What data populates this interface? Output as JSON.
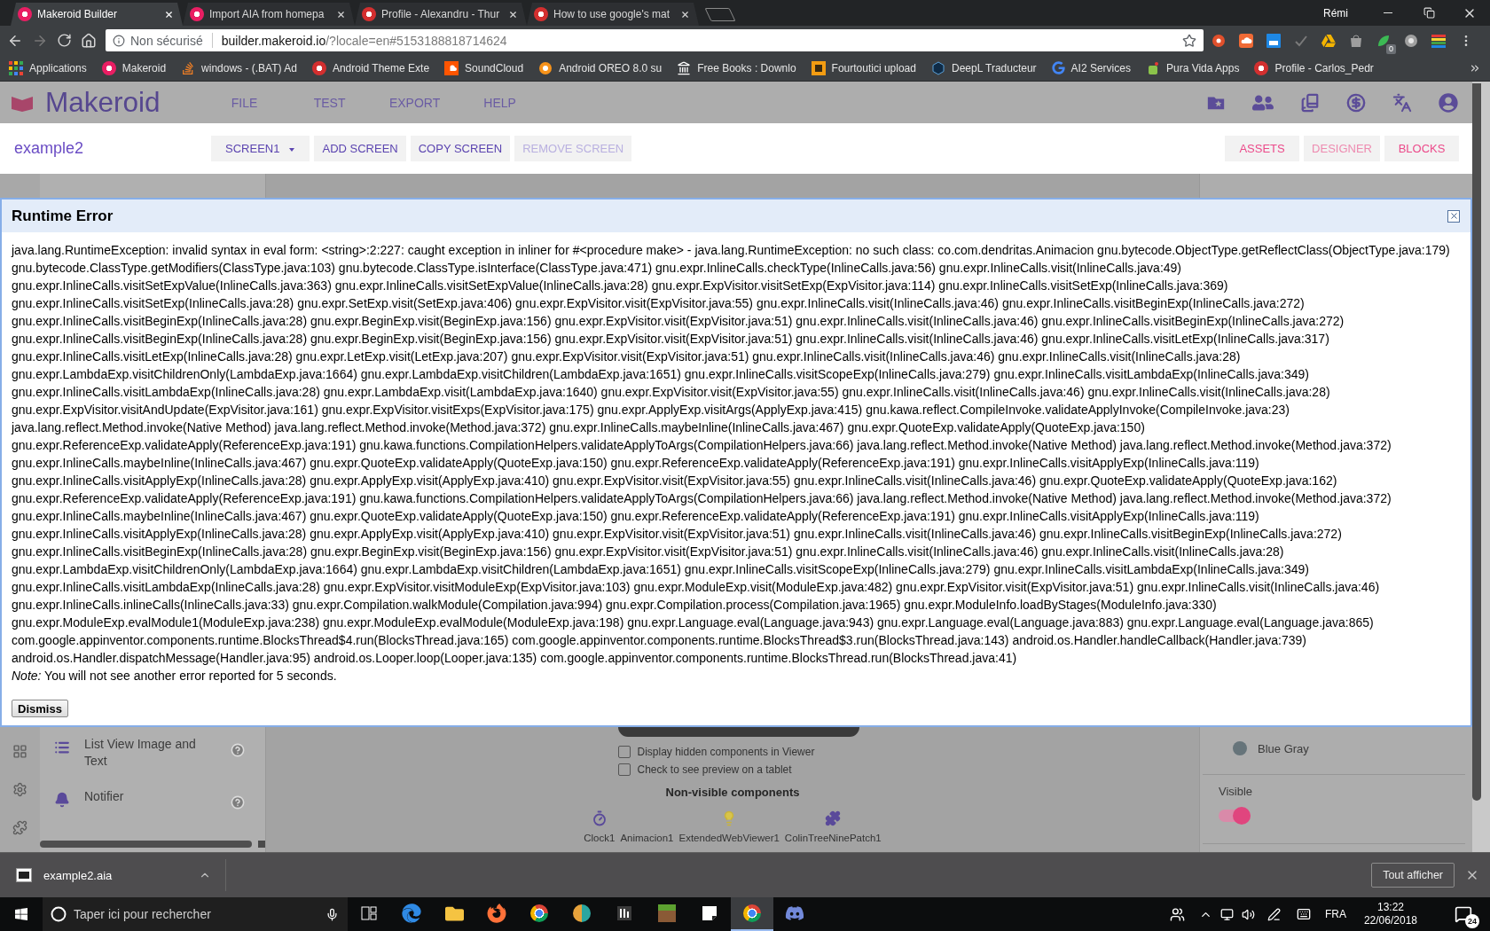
{
  "browser": {
    "tabs": [
      {
        "title": "Makeroid Builder",
        "selected": true
      },
      {
        "title": "Import AIA from homepa",
        "selected": false
      },
      {
        "title": "Profile - Alexandru - Thur",
        "selected": false
      },
      {
        "title": "How to use google's mat",
        "selected": false
      }
    ],
    "user": "Rémi",
    "address": {
      "security_label": "Non sécurisé",
      "host": "builder.makeroid.io",
      "path": "/?locale=en#5153188818714624"
    },
    "extension_badge": "0",
    "bookmarks": [
      "Applications",
      "Makeroid",
      "windows - (.BAT) Ad",
      "Android Theme Exte",
      "SoundCloud",
      "Android OREO 8.0 su",
      "Free Books : Downlo",
      "Fourtoutici upload",
      "DeepL Traducteur",
      "AI2 Services",
      "Pura Vida Apps",
      "Profile - Carlos_Pedr"
    ]
  },
  "app_header": {
    "logo_text": "Makeroid",
    "menu": [
      "FILE",
      "TEST",
      "EXPORT",
      "HELP"
    ]
  },
  "project_bar": {
    "project_name": "example2",
    "screen_actions": [
      {
        "label": "SCREEN1",
        "kind": "dropdown",
        "disabled": false
      },
      {
        "label": "ADD SCREEN",
        "kind": "button",
        "disabled": false
      },
      {
        "label": "COPY SCREEN",
        "kind": "button",
        "disabled": false
      },
      {
        "label": "REMOVE SCREEN",
        "kind": "button",
        "disabled": true
      }
    ],
    "editor_views": [
      {
        "label": "ASSETS",
        "selected": false
      },
      {
        "label": "DESIGNER",
        "selected": true
      },
      {
        "label": "BLOCKS",
        "selected": false
      }
    ]
  },
  "error_dialog": {
    "title": "Runtime Error",
    "message_lines": [
      "java.lang.RuntimeException: invalid syntax in eval form: <string>:2:227: caught exception in inliner for #<procedure make> - java.lang.RuntimeException: no such class: co.com.dendritas.Animacion gnu.bytecode.ObjectType.getReflectClass(ObjectType.java:179)",
      "gnu.bytecode.ClassType.getModifiers(ClassType.java:103) gnu.bytecode.ClassType.isInterface(ClassType.java:471) gnu.expr.InlineCalls.checkType(InlineCalls.java:56) gnu.expr.InlineCalls.visit(InlineCalls.java:49)",
      "gnu.expr.InlineCalls.visitSetExpValue(InlineCalls.java:363) gnu.expr.InlineCalls.visitSetExpValue(InlineCalls.java:28) gnu.expr.ExpVisitor.visitSetExp(ExpVisitor.java:114) gnu.expr.InlineCalls.visitSetExp(InlineCalls.java:369)",
      "gnu.expr.InlineCalls.visitSetExp(InlineCalls.java:28) gnu.expr.SetExp.visit(SetExp.java:406) gnu.expr.ExpVisitor.visit(ExpVisitor.java:55) gnu.expr.InlineCalls.visit(InlineCalls.java:46) gnu.expr.InlineCalls.visitBeginExp(InlineCalls.java:272)",
      "gnu.expr.InlineCalls.visitBeginExp(InlineCalls.java:28) gnu.expr.BeginExp.visit(BeginExp.java:156) gnu.expr.ExpVisitor.visit(ExpVisitor.java:51) gnu.expr.InlineCalls.visit(InlineCalls.java:46) gnu.expr.InlineCalls.visitBeginExp(InlineCalls.java:272)",
      "gnu.expr.InlineCalls.visitBeginExp(InlineCalls.java:28) gnu.expr.BeginExp.visit(BeginExp.java:156) gnu.expr.ExpVisitor.visit(ExpVisitor.java:51) gnu.expr.InlineCalls.visit(InlineCalls.java:46) gnu.expr.InlineCalls.visitLetExp(InlineCalls.java:317)",
      "gnu.expr.InlineCalls.visitLetExp(InlineCalls.java:28) gnu.expr.LetExp.visit(LetExp.java:207) gnu.expr.ExpVisitor.visit(ExpVisitor.java:51) gnu.expr.InlineCalls.visit(InlineCalls.java:46) gnu.expr.InlineCalls.visit(InlineCalls.java:28)",
      "gnu.expr.LambdaExp.visitChildrenOnly(LambdaExp.java:1664) gnu.expr.LambdaExp.visitChildren(LambdaExp.java:1651) gnu.expr.InlineCalls.visitScopeExp(InlineCalls.java:279) gnu.expr.InlineCalls.visitLambdaExp(InlineCalls.java:349)",
      "gnu.expr.InlineCalls.visitLambdaExp(InlineCalls.java:28) gnu.expr.LambdaExp.visit(LambdaExp.java:1640) gnu.expr.ExpVisitor.visit(ExpVisitor.java:55) gnu.expr.InlineCalls.visit(InlineCalls.java:46) gnu.expr.InlineCalls.visit(InlineCalls.java:28)",
      "gnu.expr.ExpVisitor.visitAndUpdate(ExpVisitor.java:161) gnu.expr.ExpVisitor.visitExps(ExpVisitor.java:175) gnu.expr.ApplyExp.visitArgs(ApplyExp.java:415) gnu.kawa.reflect.CompileInvoke.validateApplyInvoke(CompileInvoke.java:23)",
      "java.lang.reflect.Method.invoke(Native Method) java.lang.reflect.Method.invoke(Method.java:372) gnu.expr.InlineCalls.maybeInline(InlineCalls.java:467) gnu.expr.QuoteExp.validateApply(QuoteExp.java:150)",
      "gnu.expr.ReferenceExp.validateApply(ReferenceExp.java:191) gnu.kawa.functions.CompilationHelpers.validateApplyToArgs(CompilationHelpers.java:66) java.lang.reflect.Method.invoke(Native Method) java.lang.reflect.Method.invoke(Method.java:372)",
      "gnu.expr.InlineCalls.maybeInline(InlineCalls.java:467) gnu.expr.QuoteExp.validateApply(QuoteExp.java:150) gnu.expr.ReferenceExp.validateApply(ReferenceExp.java:191) gnu.expr.InlineCalls.visitApplyExp(InlineCalls.java:119)",
      "gnu.expr.InlineCalls.visitApplyExp(InlineCalls.java:28) gnu.expr.ApplyExp.visit(ApplyExp.java:410) gnu.expr.ExpVisitor.visit(ExpVisitor.java:55) gnu.expr.InlineCalls.visit(InlineCalls.java:46) gnu.expr.QuoteExp.validateApply(QuoteExp.java:162)",
      "gnu.expr.ReferenceExp.validateApply(ReferenceExp.java:191) gnu.kawa.functions.CompilationHelpers.validateApplyToArgs(CompilationHelpers.java:66) java.lang.reflect.Method.invoke(Native Method) java.lang.reflect.Method.invoke(Method.java:372)",
      "gnu.expr.InlineCalls.maybeInline(InlineCalls.java:467) gnu.expr.QuoteExp.validateApply(QuoteExp.java:150) gnu.expr.ReferenceExp.validateApply(ReferenceExp.java:191) gnu.expr.InlineCalls.visitApplyExp(InlineCalls.java:119)",
      "gnu.expr.InlineCalls.visitApplyExp(InlineCalls.java:28) gnu.expr.ApplyExp.visit(ApplyExp.java:410) gnu.expr.ExpVisitor.visit(ExpVisitor.java:51) gnu.expr.InlineCalls.visit(InlineCalls.java:46) gnu.expr.InlineCalls.visitBeginExp(InlineCalls.java:272)",
      "gnu.expr.InlineCalls.visitBeginExp(InlineCalls.java:28) gnu.expr.BeginExp.visit(BeginExp.java:156) gnu.expr.ExpVisitor.visit(ExpVisitor.java:51) gnu.expr.InlineCalls.visit(InlineCalls.java:46) gnu.expr.InlineCalls.visit(InlineCalls.java:28)",
      "gnu.expr.LambdaExp.visitChildrenOnly(LambdaExp.java:1664) gnu.expr.LambdaExp.visitChildren(LambdaExp.java:1651) gnu.expr.InlineCalls.visitScopeExp(InlineCalls.java:279) gnu.expr.InlineCalls.visitLambdaExp(InlineCalls.java:349)",
      "gnu.expr.InlineCalls.visitLambdaExp(InlineCalls.java:28) gnu.expr.ExpVisitor.visitModuleExp(ExpVisitor.java:103) gnu.expr.ModuleExp.visit(ModuleExp.java:482) gnu.expr.ExpVisitor.visit(ExpVisitor.java:51) gnu.expr.InlineCalls.visit(InlineCalls.java:46)",
      "gnu.expr.InlineCalls.inlineCalls(InlineCalls.java:33) gnu.expr.Compilation.walkModule(Compilation.java:994) gnu.expr.Compilation.process(Compilation.java:1965) gnu.expr.ModuleInfo.loadByStages(ModuleInfo.java:330)",
      "gnu.expr.ModuleExp.evalModule1(ModuleExp.java:238) gnu.expr.ModuleExp.evalModule(ModuleExp.java:198) gnu.expr.Language.eval(Language.java:943) gnu.expr.Language.eval(Language.java:883) gnu.expr.Language.eval(Language.java:865)",
      "com.google.appinventor.components.runtime.BlocksThread$4.run(BlocksThread.java:165) com.google.appinventor.components.runtime.BlocksThread$3.run(BlocksThread.java:143) android.os.Handler.handleCallback(Handler.java:739)",
      "android.os.Handler.dispatchMessage(Handler.java:95) android.os.Looper.loop(Looper.java:135) com.google.appinventor.components.runtime.BlocksThread.run(BlocksThread.java:41)"
    ],
    "note": "*Note:* You will not see another error reported for 5 seconds.",
    "button": "Dismiss"
  },
  "palette": {
    "items": [
      "List View Image and Text",
      "Notifier"
    ]
  },
  "viewer": {
    "display_options": [
      {
        "label": "Display hidden components in Viewer",
        "checked": false
      },
      {
        "label": "Check to see preview on a tablet",
        "checked": false
      }
    ],
    "non_visible_title": "Non-visible components",
    "non_visible_components": [
      "Clock1",
      "Animacion1",
      "ExtendedWebViewer1",
      "ColinTreeNinePatch1"
    ]
  },
  "properties": {
    "color_choice": {
      "label": "Blue Gray",
      "color": "#66747a"
    },
    "visible": {
      "label": "Visible",
      "on": true
    }
  },
  "download_bar": {
    "file_name": "example2.aia",
    "show_all_button": "Tout afficher"
  },
  "taskbar": {
    "search_placeholder": "Taper ici pour rechercher",
    "apps": [
      {
        "active": false
      },
      {
        "active": false
      },
      {
        "active": false
      },
      {
        "active": false
      },
      {
        "active": false
      },
      {
        "active": false
      },
      {
        "active": false
      },
      {
        "active": false
      },
      {
        "active": true
      },
      {
        "active": false
      }
    ],
    "language": "FRA",
    "time": "13:22",
    "date": "22/06/2018",
    "notification_count": "24"
  }
}
